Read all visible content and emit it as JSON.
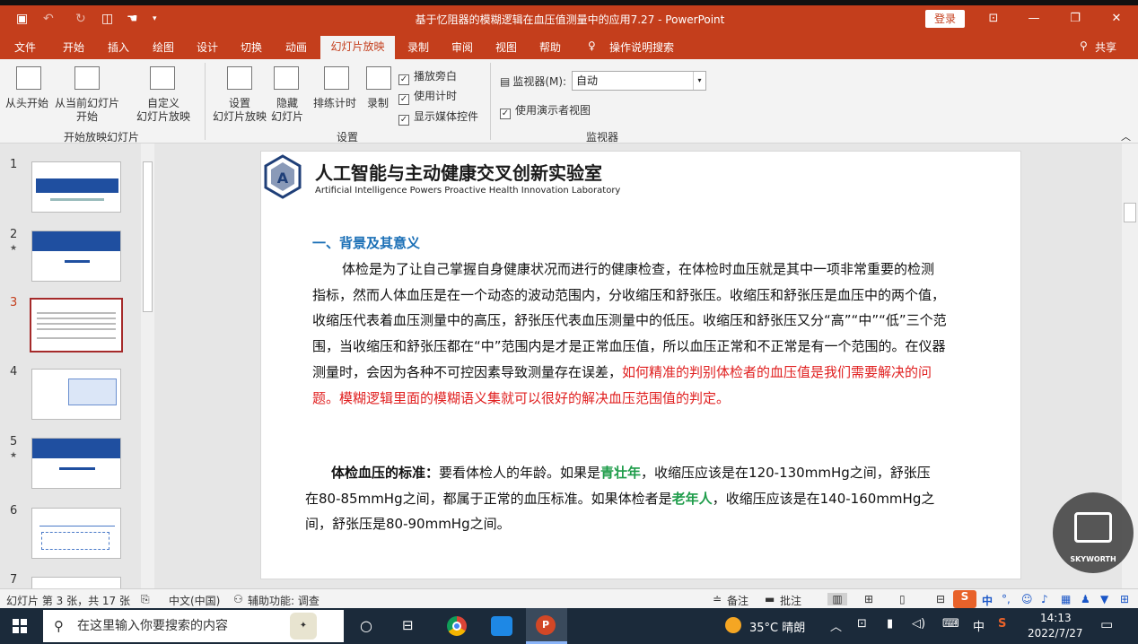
{
  "window": {
    "title": "基于忆阻器的模糊逻辑在血压值测量中的应用7.27  -  PowerPoint",
    "login": "登录"
  },
  "tabs": [
    "文件",
    "开始",
    "插入",
    "绘图",
    "设计",
    "切换",
    "动画",
    "幻灯片放映",
    "录制",
    "审阅",
    "视图",
    "帮助",
    "操作说明搜索"
  ],
  "share": "共享",
  "ribbon": {
    "from_start": "从头开始",
    "from_current_1": "从当前幻灯片",
    "from_current_2": "开始",
    "custom_1": "自定义",
    "custom_2": "幻灯片放映",
    "group_start": "开始放映幻灯片",
    "setup_1": "设置",
    "setup_2": "幻灯片放映",
    "hide_1": "隐藏",
    "hide_2": "幻灯片",
    "rehearse": "排练计时",
    "record": "录制",
    "play_narration": "播放旁白",
    "use_timings": "使用计时",
    "show_media": "显示媒体控件",
    "group_setup": "设置",
    "monitor_label": "监视器(M):",
    "monitor_value": "自动",
    "presenter_view": "使用演示者视图",
    "group_monitor": "监视器"
  },
  "thumbnails": [
    "1",
    "2",
    "3",
    "4",
    "5",
    "6",
    "7"
  ],
  "slide": {
    "lab_cn": "人工智能与主动健康交叉创新实验室",
    "lab_en": "Artificial Intelligence Powers Proactive Health Innovation Laboratory",
    "section": "一、背景及其意义",
    "p1_a": "体检是为了让自己掌握自身健康状况而进行的健康检查，在体检时血压就是其中一项非常重要的检测指标，然而人体血压是在一个动态的波动范围内，分收缩压和舒张压。收缩压和舒张压是血压中的两个值，收缩压代表着血压测量中的高压，舒张压代表血压测量中的低压。收缩压和舒张压又分“高”“中”“低”三个范围，当收缩压和舒张压都在“中”范围内是才是正常血压值，所以血压正常和不正常是有一个范围的。在仪器测量时，会因为各种不可控因素导致测量存在误差，",
    "p1_red": "如何精准的判别体检者的血压值是我们需要解决的问题。模糊逻辑里面的模糊语义集就可以很好的解决血压范围值的判定。",
    "p2_bold": "体检血压的标准：",
    "p2_a": "要看体检人的年龄。如果是",
    "p2_g1": "青壮年",
    "p2_b": "，收缩压应该是在120-130mmHg之间，舒张压在80-85mmHg之间，都属于正常的血压标准。如果体检者是",
    "p2_g2": "老年人",
    "p2_c": "，收缩压应该是在140-160mmHg之间，舒张压是80-90mmHg之间。"
  },
  "status": {
    "slide_info": "幻灯片 第 3 张，共 17 张",
    "language": "中文(中国)",
    "accessibility": "辅助功能: 调查",
    "notes": "备注",
    "comments": "批注"
  },
  "taskbar": {
    "search_placeholder": "在这里输入你要搜索的内容",
    "weather": "35°C  晴朗",
    "ime": "中",
    "time": "14:13",
    "date": "2022/7/27"
  },
  "badge": "SKYWORTH"
}
